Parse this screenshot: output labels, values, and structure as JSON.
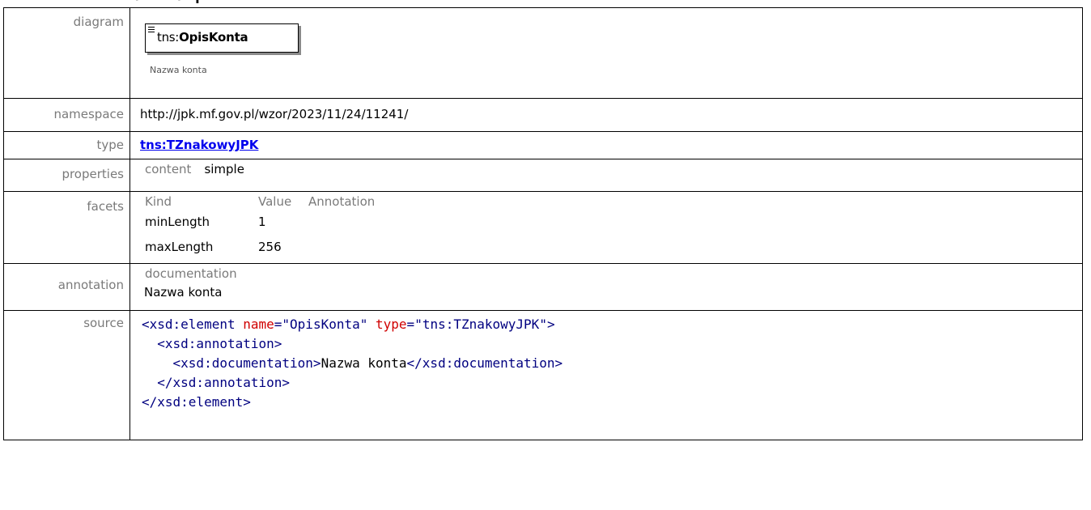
{
  "heading": {
    "text": "element ZOiS/ZOiS/Opis"
  },
  "rows": {
    "diagram": {
      "label": "diagram",
      "prefix": "tns:",
      "name": "OpisKonta",
      "caption": "Nazwa konta"
    },
    "namespace": {
      "label": "namespace",
      "value": "http://jpk.mf.gov.pl/wzor/2023/11/24/11241/"
    },
    "type": {
      "label": "type",
      "value": "tns:TZnakowyJPK"
    },
    "properties": {
      "label": "properties",
      "key": "content",
      "value": "simple"
    },
    "facets": {
      "label": "facets",
      "headers": [
        "Kind",
        "Value",
        "Annotation"
      ],
      "items": [
        {
          "kind": "minLength",
          "value": "1",
          "annotation": ""
        },
        {
          "kind": "maxLength",
          "value": "256",
          "annotation": ""
        }
      ]
    },
    "annotation": {
      "label": "annotation",
      "key": "documentation",
      "value": "Nazwa konta"
    },
    "source": {
      "label": "source",
      "lines": [
        {
          "indent": "",
          "open": "<xsd:element ",
          "attr1": "name",
          "eq1": "=",
          "val1": "\"OpisKonta\"",
          "attr2": " type",
          "eq2": "=",
          "val2": "\"tns:TZnakowyJPK\"",
          "close": ">"
        },
        {
          "indent": "  ",
          "tag": "<xsd:annotation>"
        },
        {
          "indent": "    ",
          "tagOpen": "<xsd:documentation>",
          "text": "Nazwa konta",
          "tagClose": "</xsd:documentation>"
        },
        {
          "indent": "  ",
          "tag": "</xsd:annotation>"
        },
        {
          "indent": "",
          "tag": "</xsd:element>"
        }
      ]
    }
  },
  "colors": {
    "label": "#7a7a7a",
    "link": "#0000ee",
    "xml_tag": "#000080",
    "xml_attr": "#d00000"
  }
}
